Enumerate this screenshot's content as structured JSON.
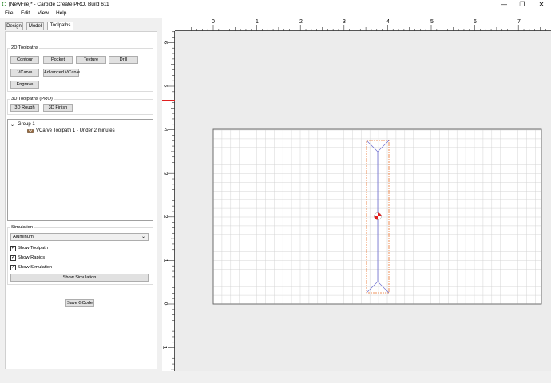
{
  "window": {
    "title": "[NewFile]* - Carbide Create PRO, Build 611",
    "icon": "carbide-c-icon",
    "minimize": "—",
    "restore": "❐",
    "close": "✕"
  },
  "menu": {
    "items": [
      "File",
      "Edit",
      "View",
      "Help"
    ]
  },
  "tabs": {
    "items": [
      "Design",
      "Model",
      "Toolpaths"
    ],
    "active": "Toolpaths"
  },
  "toolpaths_2d": {
    "title": "2D Toolpaths",
    "contour": "Contour",
    "pocket": "Pocket",
    "texture": "Texture",
    "drill": "Drill",
    "vcarve": "VCarve",
    "advanced_vcarve": "Advanced VCarve",
    "engrave": "Engrave"
  },
  "toolpaths_3d": {
    "title": "3D Toolpaths (PRO)",
    "rough": "3D Rough",
    "finish": "3D Finish"
  },
  "tree": {
    "group": "Group 1",
    "item": "VCarve Toolpath 1 - Under 2 minutes"
  },
  "simulation": {
    "title": "Simulation",
    "material": "Aluminum",
    "show_toolpath": "Show Toolpath",
    "show_rapids": "Show Rapids",
    "show_simulation_check": "Show Simulation",
    "show_simulation_button": "Show Simulation",
    "show_toolpath_checked": true,
    "show_rapids_checked": true,
    "show_simulation_checked": true
  },
  "save_gcode": "Save GCode",
  "ruler": {
    "x_labels": [
      "0",
      "1",
      "2",
      "3",
      "4",
      "5",
      "6",
      "7"
    ],
    "y_labels": [
      "6",
      "5",
      "4",
      "3",
      "2",
      "1",
      "0",
      "-1"
    ]
  },
  "colors": {
    "toolpath_outline": "#e8702a",
    "centerline": "#6a6ad0",
    "grid": "#d4d4d4",
    "origin_marker": "#e02020",
    "ruler_marker": "#e02020"
  }
}
